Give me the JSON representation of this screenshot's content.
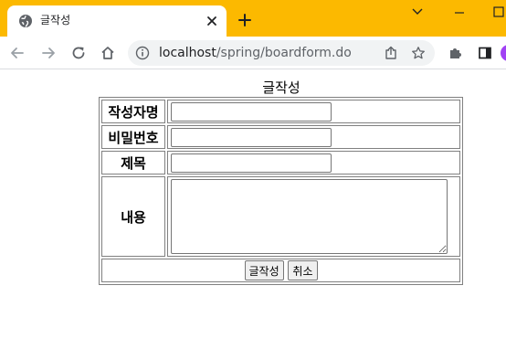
{
  "browser": {
    "tab": {
      "title": "글작성",
      "favicon": "globe-icon"
    },
    "omnibox": {
      "url_host": "localhost",
      "url_path": "/spring/boardform.do"
    },
    "colors": {
      "titlebar": "#fcb900",
      "profile": "#a142f4"
    }
  },
  "page": {
    "title": "글작성",
    "form": {
      "writer_label": "작성자명",
      "writer_value": "",
      "password_label": "비밀번호",
      "password_value": "",
      "subject_label": "제목",
      "subject_value": "",
      "content_label": "내용",
      "content_value": "",
      "submit_label": "글작성",
      "cancel_label": "취소"
    }
  }
}
